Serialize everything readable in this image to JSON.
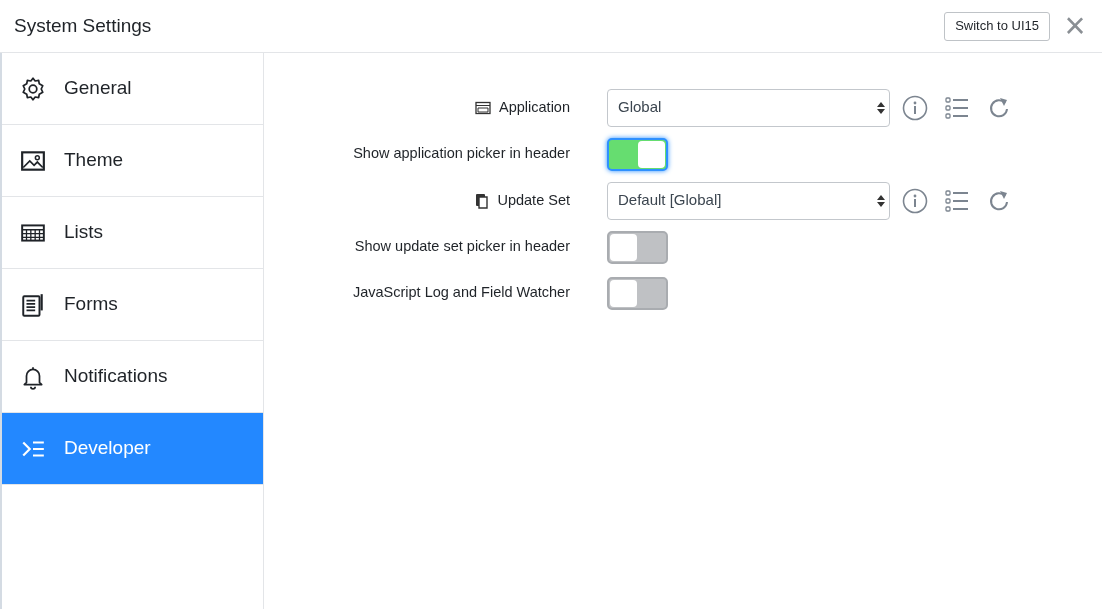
{
  "window": {
    "title": "System Settings",
    "switch_button": "Switch to UI15",
    "close": "×"
  },
  "sidebar": {
    "items": [
      {
        "label": "General",
        "selected": false
      },
      {
        "label": "Theme",
        "selected": false
      },
      {
        "label": "Lists",
        "selected": false
      },
      {
        "label": "Forms",
        "selected": false
      },
      {
        "label": "Notifications",
        "selected": false
      },
      {
        "label": "Developer",
        "selected": true
      }
    ]
  },
  "settings": [
    {
      "kind": "select",
      "label": "Application",
      "value": "Global"
    },
    {
      "kind": "toggle",
      "label": "Show application picker in header",
      "on": true,
      "focused": true
    },
    {
      "kind": "select",
      "label": "Update Set",
      "value": "Default [Global]"
    },
    {
      "kind": "toggle",
      "label": "Show update set picker in header",
      "on": false,
      "focused": false
    },
    {
      "kind": "toggle",
      "label": "JavaScript Log and Field Watcher",
      "on": false,
      "focused": false
    }
  ]
}
